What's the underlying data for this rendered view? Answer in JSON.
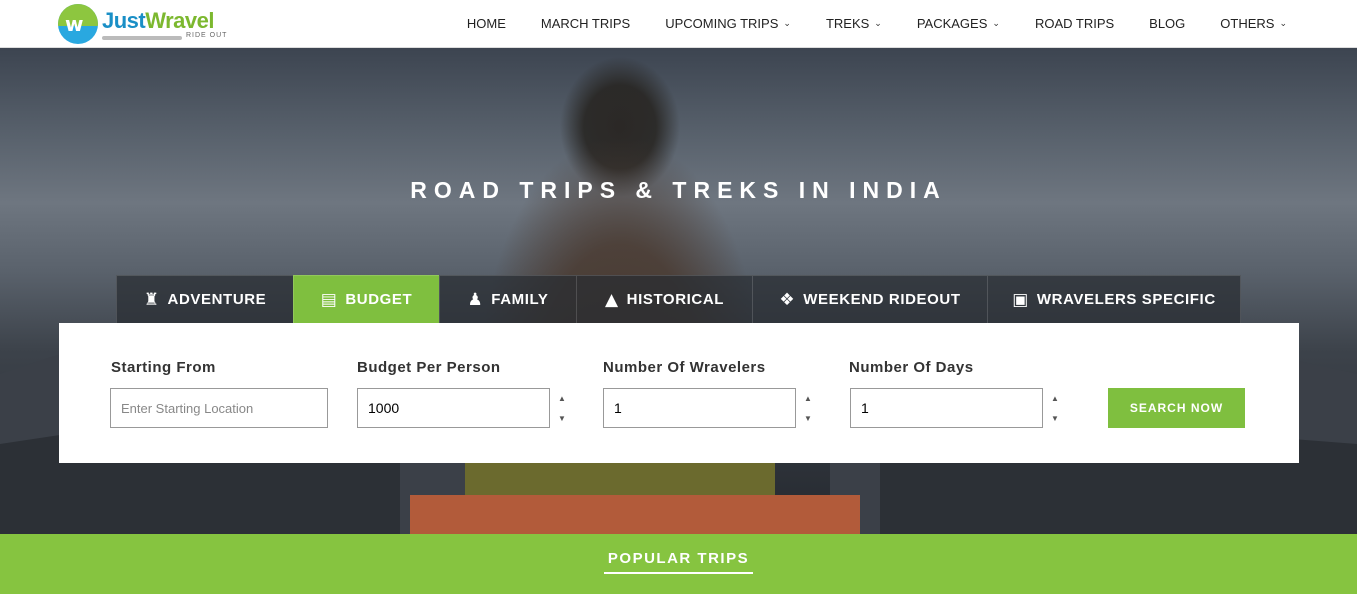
{
  "brand": {
    "logo_part1": "Just",
    "logo_part2": "Wravel",
    "tagline": "RIDE OUT"
  },
  "nav": [
    {
      "label": "HOME",
      "dropdown": false
    },
    {
      "label": "MARCH TRIPS",
      "dropdown": false
    },
    {
      "label": "UPCOMING TRIPS",
      "dropdown": true
    },
    {
      "label": "TREKS",
      "dropdown": true
    },
    {
      "label": "PACKAGES",
      "dropdown": true
    },
    {
      "label": "ROAD TRIPS",
      "dropdown": false
    },
    {
      "label": "BLOG",
      "dropdown": false
    },
    {
      "label": "OTHERS",
      "dropdown": true
    }
  ],
  "hero": {
    "title": "ROAD TRIPS & TREKS IN INDIA"
  },
  "tabs": [
    {
      "label": "ADVENTURE",
      "icon": "hiker-icon",
      "active": false
    },
    {
      "label": "BUDGET",
      "icon": "wallet-icon",
      "active": true
    },
    {
      "label": "FAMILY",
      "icon": "family-icon",
      "active": false
    },
    {
      "label": "HISTORICAL",
      "icon": "monument-icon",
      "active": false
    },
    {
      "label": "WEEKEND RIDEOUT",
      "icon": "pin-icon",
      "active": false
    },
    {
      "label": "WRAVELERS SPECIFIC",
      "icon": "bag-icon",
      "active": false
    }
  ],
  "search": {
    "starting_from": {
      "label": "Starting From",
      "placeholder": "Enter Starting Location",
      "value": ""
    },
    "budget": {
      "label": "Budget Per Person",
      "value": "1000"
    },
    "wravelers": {
      "label": "Number Of Wravelers",
      "value": "1"
    },
    "days": {
      "label": "Number Of Days",
      "value": "1"
    },
    "button_label": "SEARCH NOW"
  },
  "popular": {
    "title": "POPULAR TRIPS"
  },
  "colors": {
    "accent_green": "#7fbf3f",
    "brand_blue": "#1a8fc6"
  }
}
